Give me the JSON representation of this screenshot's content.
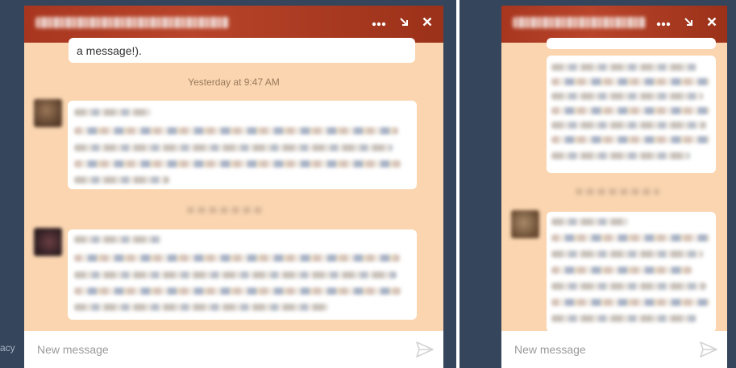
{
  "left_panel": {
    "header": {
      "more_icon": "more-horizontal-icon",
      "minimize_icon": "arrow-down-right-icon",
      "close_icon": "close-icon"
    },
    "partial_message": "a message!).",
    "timestamp": "Yesterday at 9:47 AM",
    "composer": {
      "placeholder": "New message",
      "send_icon": "paper-plane-icon"
    }
  },
  "right_panel": {
    "header": {
      "more_icon": "more-horizontal-icon",
      "minimize_icon": "arrow-down-right-icon",
      "close_icon": "close-icon"
    },
    "composer": {
      "placeholder": "New message",
      "send_icon": "paper-plane-icon"
    }
  },
  "footer_fragment": "acy",
  "colors": {
    "page_background": "#35465c",
    "header_accent": "#a8361f",
    "chat_background": "#fad5b0",
    "bubble_background": "#ffffff"
  }
}
